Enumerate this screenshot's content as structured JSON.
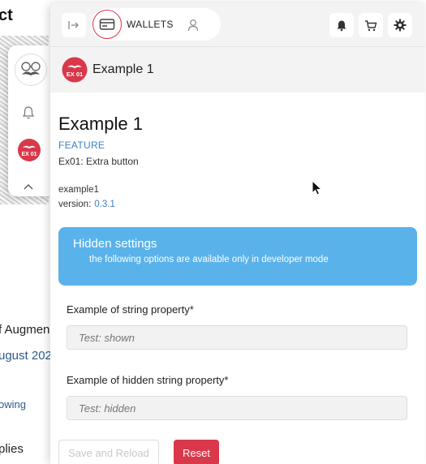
{
  "background": {
    "title_fragment": "ct",
    "text_fragments": [
      "f Augmen",
      "ugust 202",
      "owing",
      "plies"
    ]
  },
  "colors": {
    "brand_red": "#d9384a",
    "info_blue": "#5ab2ea",
    "link_blue": "#3e80c1"
  },
  "mini_panel": {
    "avatar_icon": "mustache-avatar-icon",
    "bell_icon": "bell-icon",
    "plugin_logo_text": "EX 01",
    "chevron_icon": "chevron-up-icon"
  },
  "topbar": {
    "wallet_label": "WALLETS",
    "icons": [
      "sidebar-toggle-icon",
      "wallet-icon",
      "user-icon",
      "bell-icon",
      "cart-icon",
      "gear-icon"
    ]
  },
  "plugin_header": {
    "logo_text": "EX 01",
    "name": "Example 1"
  },
  "details": {
    "title": "Example 1",
    "type": "FEATURE",
    "description": "Ex01: Extra button",
    "package": "example1",
    "version_label": "version:",
    "version": "0.3.1"
  },
  "hidden_settings": {
    "title": "Hidden settings",
    "subtitle": "the following options are available only in developer mode"
  },
  "fields": [
    {
      "label": "Example of string property*",
      "placeholder": "Test: shown"
    },
    {
      "label": "Example of hidden string property*",
      "placeholder": "Test: hidden"
    }
  ],
  "buttons": {
    "save": "Save and Reload",
    "reset": "Reset"
  }
}
